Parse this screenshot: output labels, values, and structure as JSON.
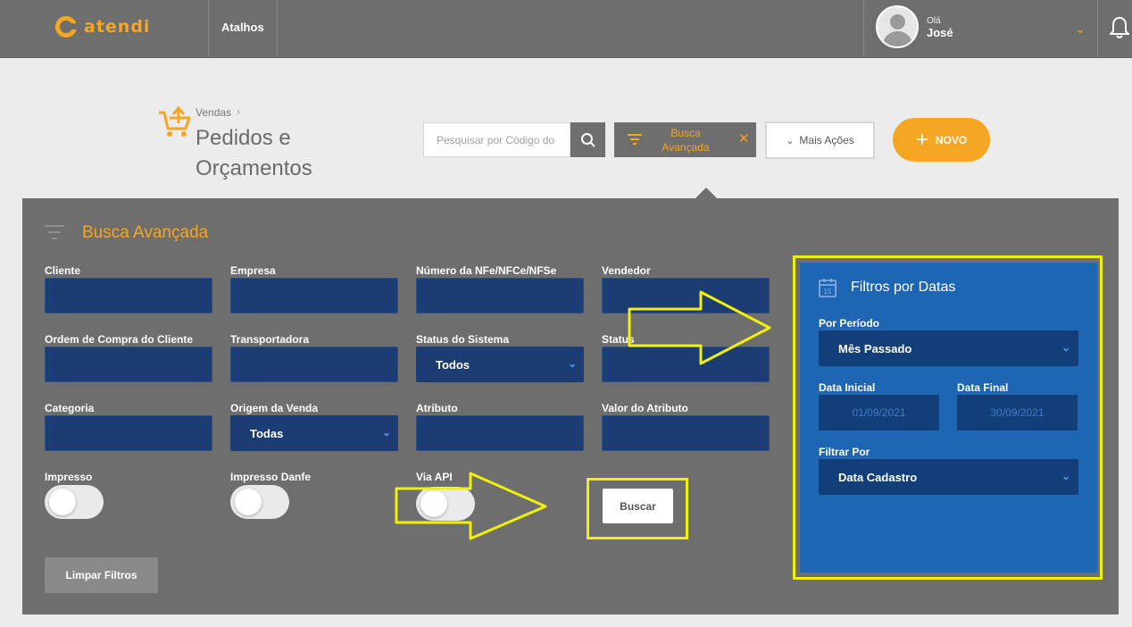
{
  "topbar": {
    "logo_text": "atendi",
    "shortcuts_label": "Atalhos",
    "greeting": "Olá",
    "user_name": "José"
  },
  "header": {
    "breadcrumb": "Vendas",
    "title": "Pedidos e Orçamentos",
    "search_placeholder": "Pesquisar por Código do Pedido",
    "advanced_search_label": "Busca Avançada",
    "more_actions_label": "Mais Ações",
    "new_label": "NOVO"
  },
  "panel": {
    "title": "Busca Avançada",
    "fields": {
      "cliente": "Cliente",
      "empresa": "Empresa",
      "numero_nf": "Número da NFe/NFCe/NFSe",
      "vendedor": "Vendedor",
      "ordem_compra": "Ordem de Compra do Cliente",
      "transportadora": "Transportadora",
      "status_sistema": "Status do Sistema",
      "status_sistema_value": "Todos",
      "status": "Status",
      "categoria": "Categoria",
      "origem_venda": "Origem da Venda",
      "origem_venda_value": "Todas",
      "atributo": "Atributo",
      "valor_atributo": "Valor do Atributo",
      "impresso": "Impresso",
      "impresso_danfe": "Impresso Danfe",
      "via_api": "Via API"
    },
    "buscar_label": "Buscar",
    "limpar_label": "Limpar Filtros"
  },
  "date_filters": {
    "title": "Filtros por Datas",
    "periodo_label": "Por Período",
    "periodo_value": "Mês Passado",
    "data_inicial_label": "Data Inicial",
    "data_inicial_value": "01/09/2021",
    "data_final_label": "Data Final",
    "data_final_value": "30/09/2021",
    "filtrar_por_label": "Filtrar Por",
    "filtrar_por_value": "Data Cadastro"
  },
  "colors": {
    "accent": "#f5a623",
    "dark_panel": "#6e6e6e",
    "field_blue": "#1b3d73",
    "date_panel_blue": "#1e65b3",
    "highlight_yellow": "#f0f00a"
  }
}
